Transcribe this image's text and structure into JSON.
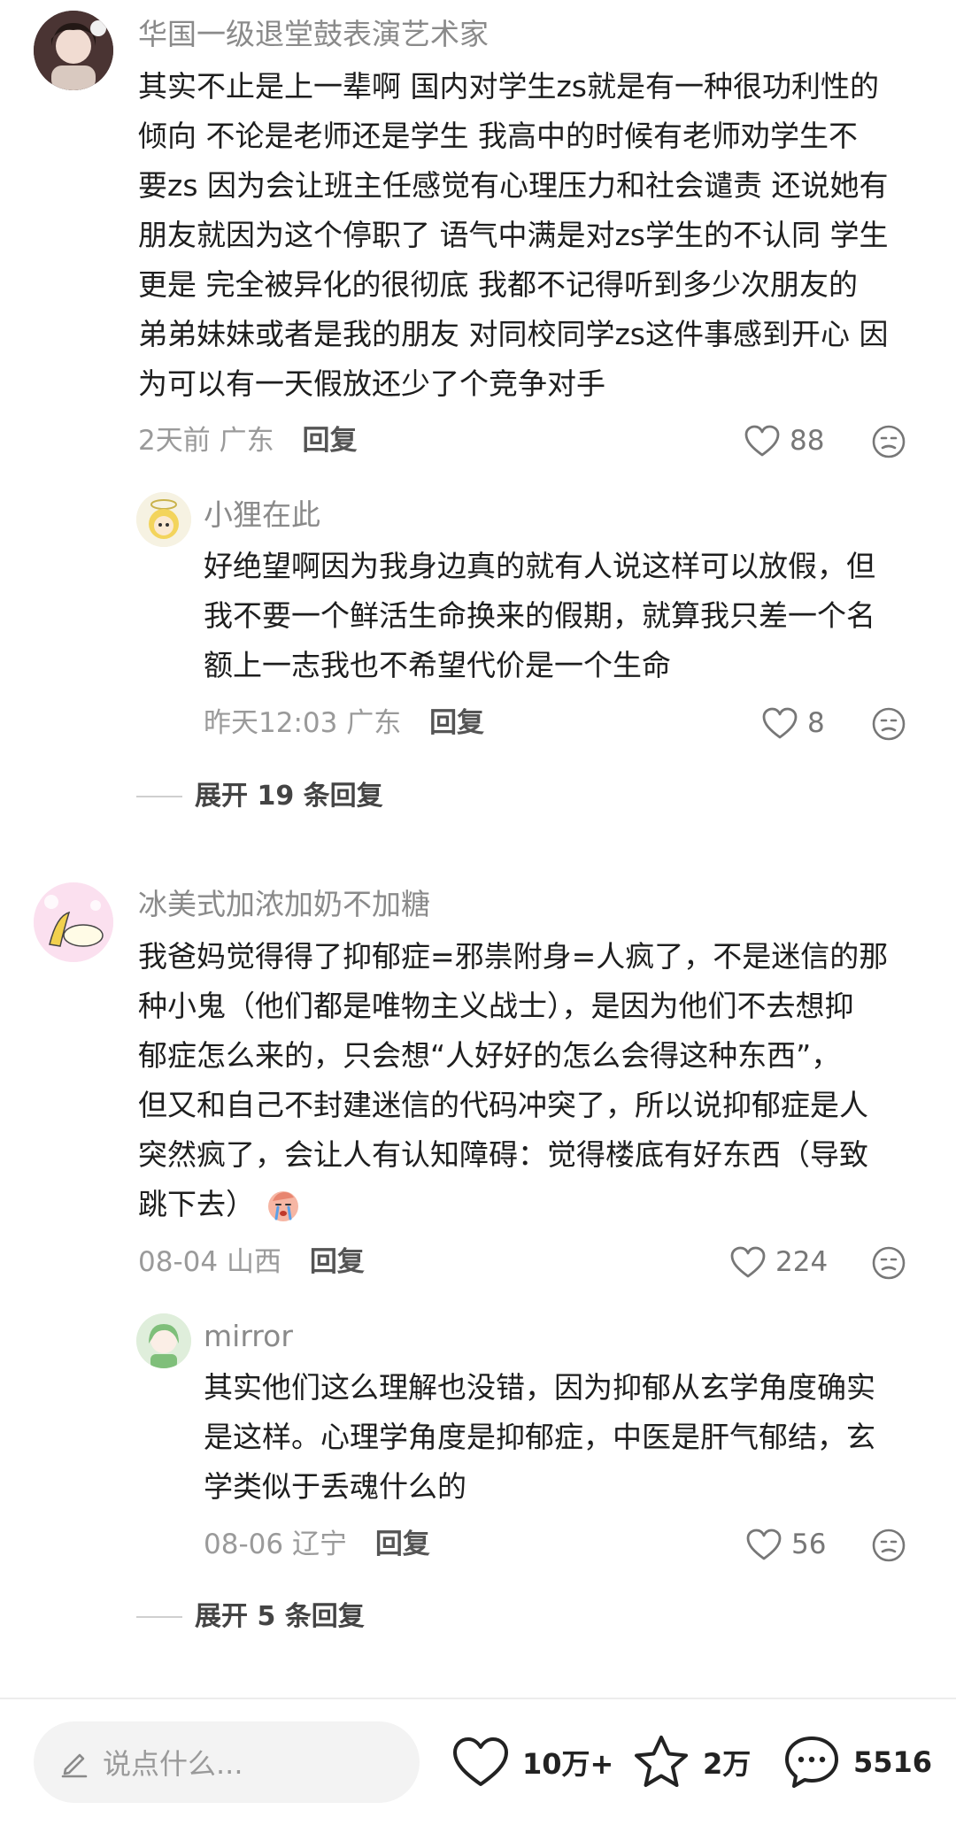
{
  "comments": [
    {
      "username": "华国一级退堂鼓表演艺术家",
      "avatar_icon": "user-avatar-dark-hair",
      "lines": [
        "其实不止是上一辈啊 国内对学生zs就是有一种很功利性的",
        "倾向 不论是老师还是学生  我高中的时候有老师劝学生不",
        "要zs 因为会让班主任感觉有心理压力和社会谴责 还说她有",
        "朋友就因为这个停职了 语气中满是对zs学生的不认同 学生",
        "更是 完全被异化的很彻底 我都不记得听到多少次朋友的",
        "弟弟妹妹或者是我的朋友 对同校同学zs这件事感到开心 因",
        "为可以有一天假放还少了个竞争对手"
      ],
      "time": "2天前",
      "location": "广东",
      "reply_label": "回复",
      "likes": "88",
      "reply": {
        "username": "小狸在此",
        "avatar_icon": "user-avatar-yellow-character",
        "lines": [
          "好绝望啊因为我身边真的就有人说这样可以放假，但",
          "我不要一个鲜活生命换来的假期，就算我只差一个名",
          "额上一志我也不希望代价是一个生命"
        ],
        "time": "昨天12:03",
        "location": "广东",
        "reply_label": "回复",
        "likes": "8"
      },
      "expand_label": "展开 19 条回复"
    },
    {
      "username": "冰美式加浓加奶不加糖",
      "avatar_icon": "user-avatar-pink-cartoon",
      "lines": [
        "我爸妈觉得得了抑郁症=邪祟附身=人疯了，不是迷信的那",
        "种小鬼（他们都是唯物主义战士），是因为他们不去想抑",
        "郁症怎么来的，只会想“人好好的怎么会得这种东西”，",
        "但又和自己不封建迷信的代码冲突了，所以说抑郁症是人",
        "突然疯了，会让人有认知障碍：觉得楼底有好东西（导致",
        "跳下去）"
      ],
      "emoji_icon": "crying-face-emoji",
      "time": "08-04",
      "location": "山西",
      "reply_label": "回复",
      "likes": "224",
      "reply": {
        "username": "mirror",
        "avatar_icon": "user-avatar-green-anime",
        "lines": [
          "其实他们这么理解也没错，因为抑郁从玄学角度确实",
          "是这样。心理学角度是抑郁症，中医是肝气郁结，玄",
          "学类似于丢魂什么的"
        ],
        "time": "08-06",
        "location": "辽宁",
        "reply_label": "回复",
        "likes": "56"
      },
      "expand_label": "展开 5 条回复"
    }
  ],
  "bottom_bar": {
    "placeholder": "说点什么...",
    "like_count": "10万+",
    "favorite_count": "2万",
    "comment_count": "5516"
  }
}
